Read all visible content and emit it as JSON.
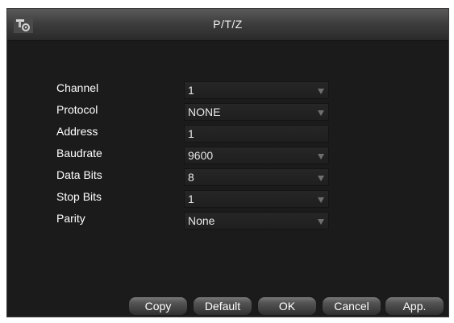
{
  "window": {
    "title": "P/T/Z",
    "icon": "settings-tools-icon"
  },
  "form": {
    "fields": [
      {
        "label": "Channel",
        "value": "1",
        "type": "dropdown"
      },
      {
        "label": "Protocol",
        "value": "NONE",
        "type": "dropdown"
      },
      {
        "label": "Address",
        "value": "1",
        "type": "text"
      },
      {
        "label": "Baudrate",
        "value": "9600",
        "type": "dropdown"
      },
      {
        "label": "Data Bits",
        "value": "8",
        "type": "dropdown"
      },
      {
        "label": "Stop Bits",
        "value": "1",
        "type": "dropdown"
      },
      {
        "label": "Parity",
        "value": "None",
        "type": "dropdown"
      }
    ]
  },
  "buttons": {
    "copy": "Copy",
    "default": "Default",
    "ok": "OK",
    "cancel": "Cancel",
    "apply": "App."
  },
  "colors": {
    "panel_bg": "#1b1b1b",
    "field_bg": "#232323",
    "text": "#ffffff"
  }
}
